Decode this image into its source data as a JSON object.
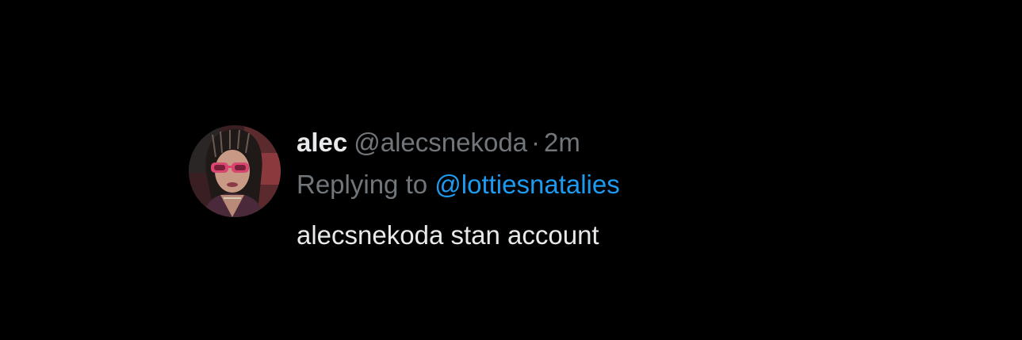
{
  "tweet": {
    "display_name": "alec",
    "handle": "@alecsnekoda",
    "separator": "·",
    "time": "2m",
    "replying_prefix": "Replying to",
    "reply_target": "@lottiesnatalies",
    "text": "alecsnekoda stan account"
  },
  "colors": {
    "background": "#000000",
    "primary_text": "#e7e9ea",
    "secondary_text": "#71767b",
    "link": "#1d9bf0",
    "sunglasses": "#d9466f"
  },
  "avatar": {
    "icon": "user-avatar-photo"
  }
}
